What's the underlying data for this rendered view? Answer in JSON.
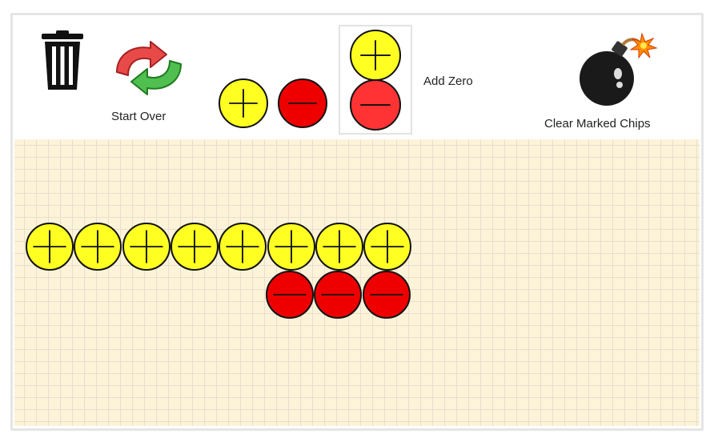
{
  "toolbar": {
    "trash_icon": "trash-can-icon",
    "start_over_label": "Start Over",
    "start_over_icon": "refresh-arrows-icon",
    "add_zero_label": "Add Zero",
    "clear_marked_label": "Clear Marked Chips",
    "clear_marked_icon": "bomb-icon"
  },
  "palette": {
    "positive_chip": {
      "sign": "+",
      "color": "#ffff22"
    },
    "negative_chip": {
      "sign": "−",
      "color": "#ee0000"
    },
    "zero_pair": [
      "+",
      "−"
    ]
  },
  "colors": {
    "positive": "#ffff22",
    "negative": "#ee0000",
    "zero_negative": "#ff3333",
    "workspace": "#fdf3d9"
  },
  "workspace": {
    "rows": [
      {
        "sign": "+",
        "count": 8
      },
      {
        "sign": "−",
        "count": 3
      }
    ]
  }
}
